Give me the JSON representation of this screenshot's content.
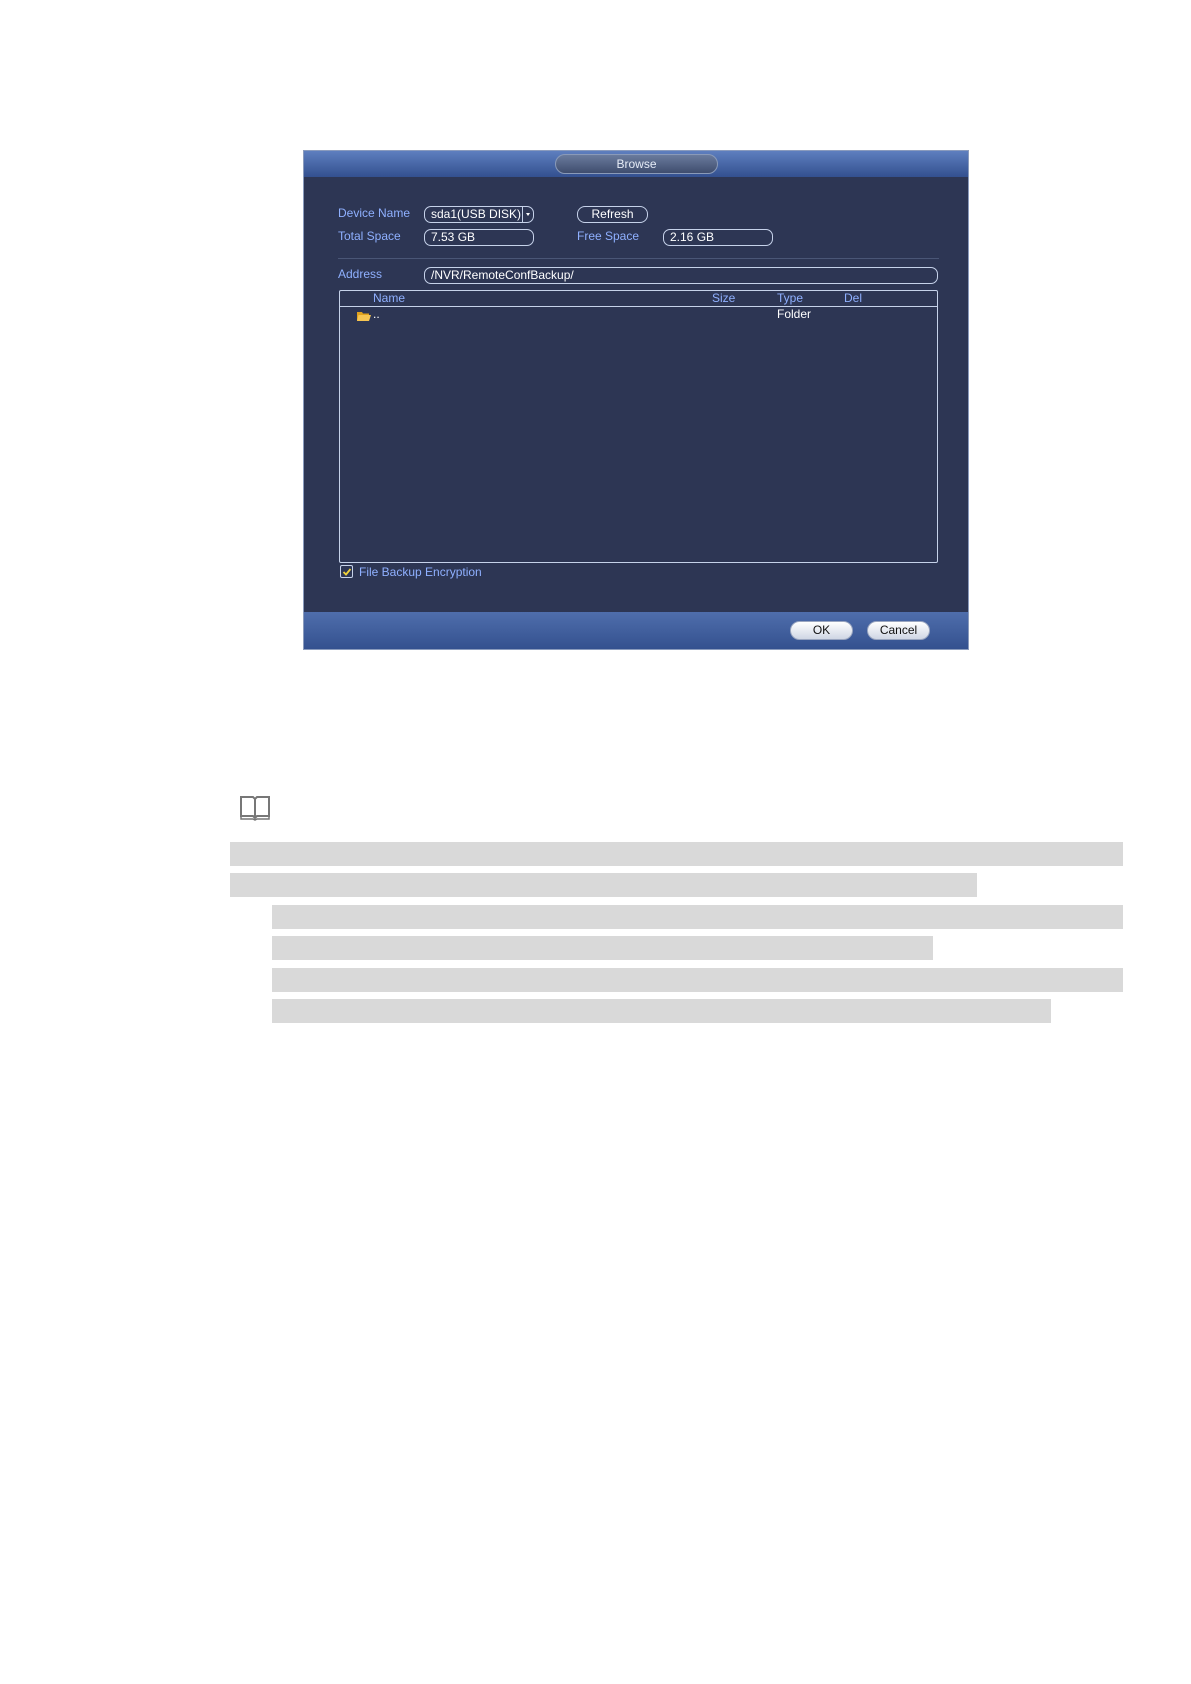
{
  "dialog": {
    "title": "Browse",
    "device_name_label": "Device Name",
    "device_name_value": "sda1(USB DISK)",
    "refresh_label": "Refresh",
    "total_space_label": "Total Space",
    "total_space_value": "7.53 GB",
    "free_space_label": "Free Space",
    "free_space_value": "2.16 GB",
    "address_label": "Address",
    "address_value": "/NVR/RemoteConfBackup/",
    "table": {
      "columns": {
        "name": "Name",
        "size": "Size",
        "type": "Type",
        "del": "Del"
      },
      "rows": [
        {
          "name": "..",
          "size": "",
          "type": "Folder",
          "icon": "folder-icon"
        }
      ]
    },
    "encryption_label": "File Backup Encryption",
    "encryption_checked": true,
    "ok_label": "OK",
    "cancel_label": "Cancel"
  },
  "note": {
    "icon": "book-icon"
  },
  "colors": {
    "dialog_bg": "#2d3654",
    "label_blue": "#8fb0ff",
    "title_bar": "#4f6eac",
    "redaction_gray": "#d9d9d9"
  }
}
